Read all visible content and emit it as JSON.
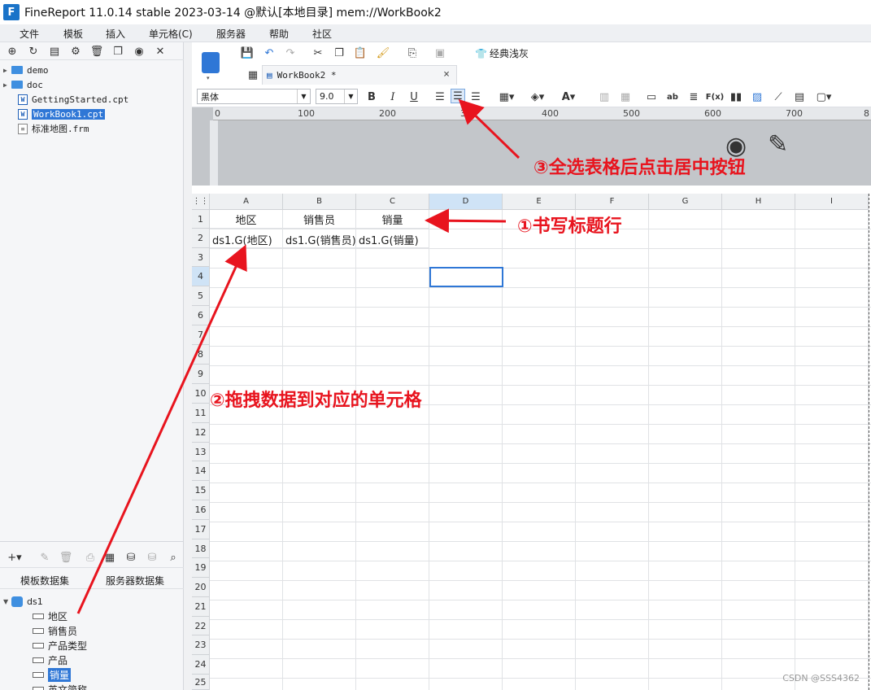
{
  "window": {
    "title": "FineReport 11.0.14 stable 2023-03-14 @默认[本地目录]    mem://WorkBook2",
    "logo": "F"
  },
  "menu": [
    "文件",
    "模板",
    "插入",
    "单元格(C)",
    "服务器",
    "帮助",
    "社区"
  ],
  "left_toolbar_icons": [
    "new-folder-icon",
    "refresh-icon",
    "open-icon",
    "settings-icon",
    "delete-icon",
    "copy-icon",
    "locate-icon",
    "collapse-icon"
  ],
  "file_tree": [
    {
      "name": "demo",
      "type": "folder"
    },
    {
      "name": "doc",
      "type": "folder"
    },
    {
      "name": "GettingStarted.cpt",
      "type": "cpt"
    },
    {
      "name": "WorkBook1.cpt",
      "type": "cpt",
      "selected": true
    },
    {
      "name": "标准地图.frm",
      "type": "frm"
    }
  ],
  "dataset_tabs": [
    "模板数据集",
    "服务器数据集"
  ],
  "dataset": {
    "name": "ds1",
    "fields": [
      "地区",
      "销售员",
      "产品类型",
      "产品",
      "销量",
      "英文简称"
    ],
    "selected_field": "销量"
  },
  "toolbar": {
    "theme_label": "经典浅灰"
  },
  "tab": {
    "label": "WorkBook2 *",
    "close": "×"
  },
  "format": {
    "font": "黑体",
    "size": "9.0"
  },
  "ruler_labels": [
    "0",
    "100",
    "200",
    "300",
    "400",
    "500",
    "600",
    "700",
    "8"
  ],
  "columns": [
    "A",
    "B",
    "C",
    "D",
    "E",
    "F",
    "G",
    "H",
    "I"
  ],
  "rows": [
    "1",
    "2",
    "3",
    "4",
    "5",
    "6",
    "7",
    "8",
    "9",
    "10",
    "11",
    "12",
    "13",
    "14",
    "15",
    "16",
    "17",
    "18",
    "19",
    "20",
    "21",
    "22",
    "23",
    "24",
    "25"
  ],
  "cells": {
    "A1": "地区",
    "B1": "销售员",
    "C1": "销量",
    "A2": "ds1.G(地区)",
    "B2": "ds1.G(销售员)",
    "C2": "ds1.G(销量)"
  },
  "annotations": {
    "step1": "①书写标题行",
    "step2": "②拖拽数据到对应的单元格",
    "step3": "③全选表格后点击居中按钮"
  },
  "watermark": "CSDN @SSS4362",
  "colors": {
    "accent": "#2f77d6",
    "annotation": "#e8141e"
  }
}
